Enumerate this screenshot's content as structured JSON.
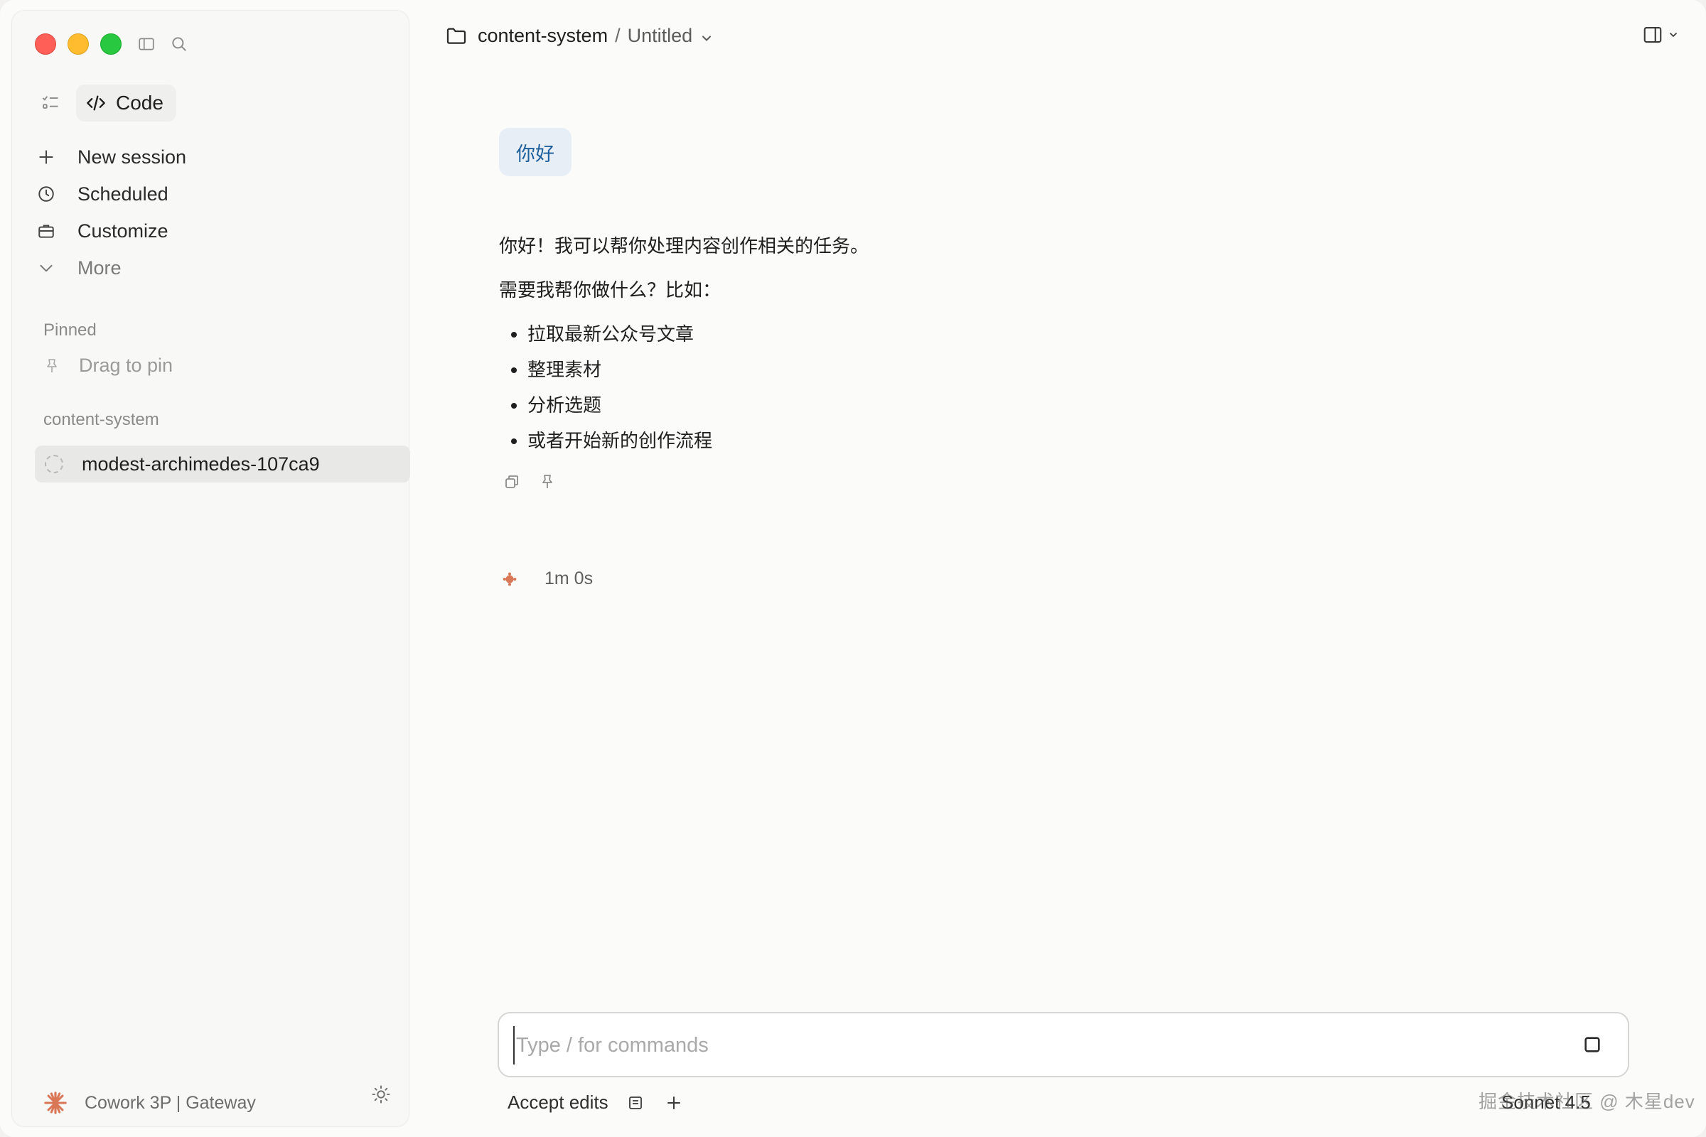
{
  "sidebar": {
    "mode_label": "Code",
    "nav": [
      {
        "label": "New session",
        "icon": "plus-icon"
      },
      {
        "label": "Scheduled",
        "icon": "clock-icon"
      },
      {
        "label": "Customize",
        "icon": "briefcase-icon"
      },
      {
        "label": "More",
        "icon": "chevron-down-icon"
      }
    ],
    "pinned_label": "Pinned",
    "pin_hint": "Drag to pin",
    "project_label": "content-system",
    "active_session": "modest-archimedes-107ca9",
    "footer_label": "Cowork 3P | Gateway"
  },
  "header": {
    "project": "content-system",
    "separator": "/",
    "title": "Untitled"
  },
  "conversation": {
    "user_message": "你好",
    "assistant": {
      "greeting": "你好！我可以帮你处理内容创作相关的任务。",
      "question": "需要我帮你做什么？比如：",
      "items": [
        "拉取最新公众号文章",
        "整理素材",
        "分析选题",
        "或者开始新的创作流程"
      ]
    },
    "elapsed": "1m 0s"
  },
  "composer": {
    "placeholder": "Type / for commands",
    "value": "",
    "mode_label": "Accept edits",
    "model_label": "Sonnet 4.5"
  },
  "watermark": "掘金技术社区 @ 木星dev",
  "colors": {
    "accent": "#d97757",
    "user_bubble_bg": "#e7eef6",
    "user_bubble_text": "#1d5d9a",
    "close": "#ff5f57",
    "minimize": "#febc2e",
    "zoom": "#28c840"
  }
}
